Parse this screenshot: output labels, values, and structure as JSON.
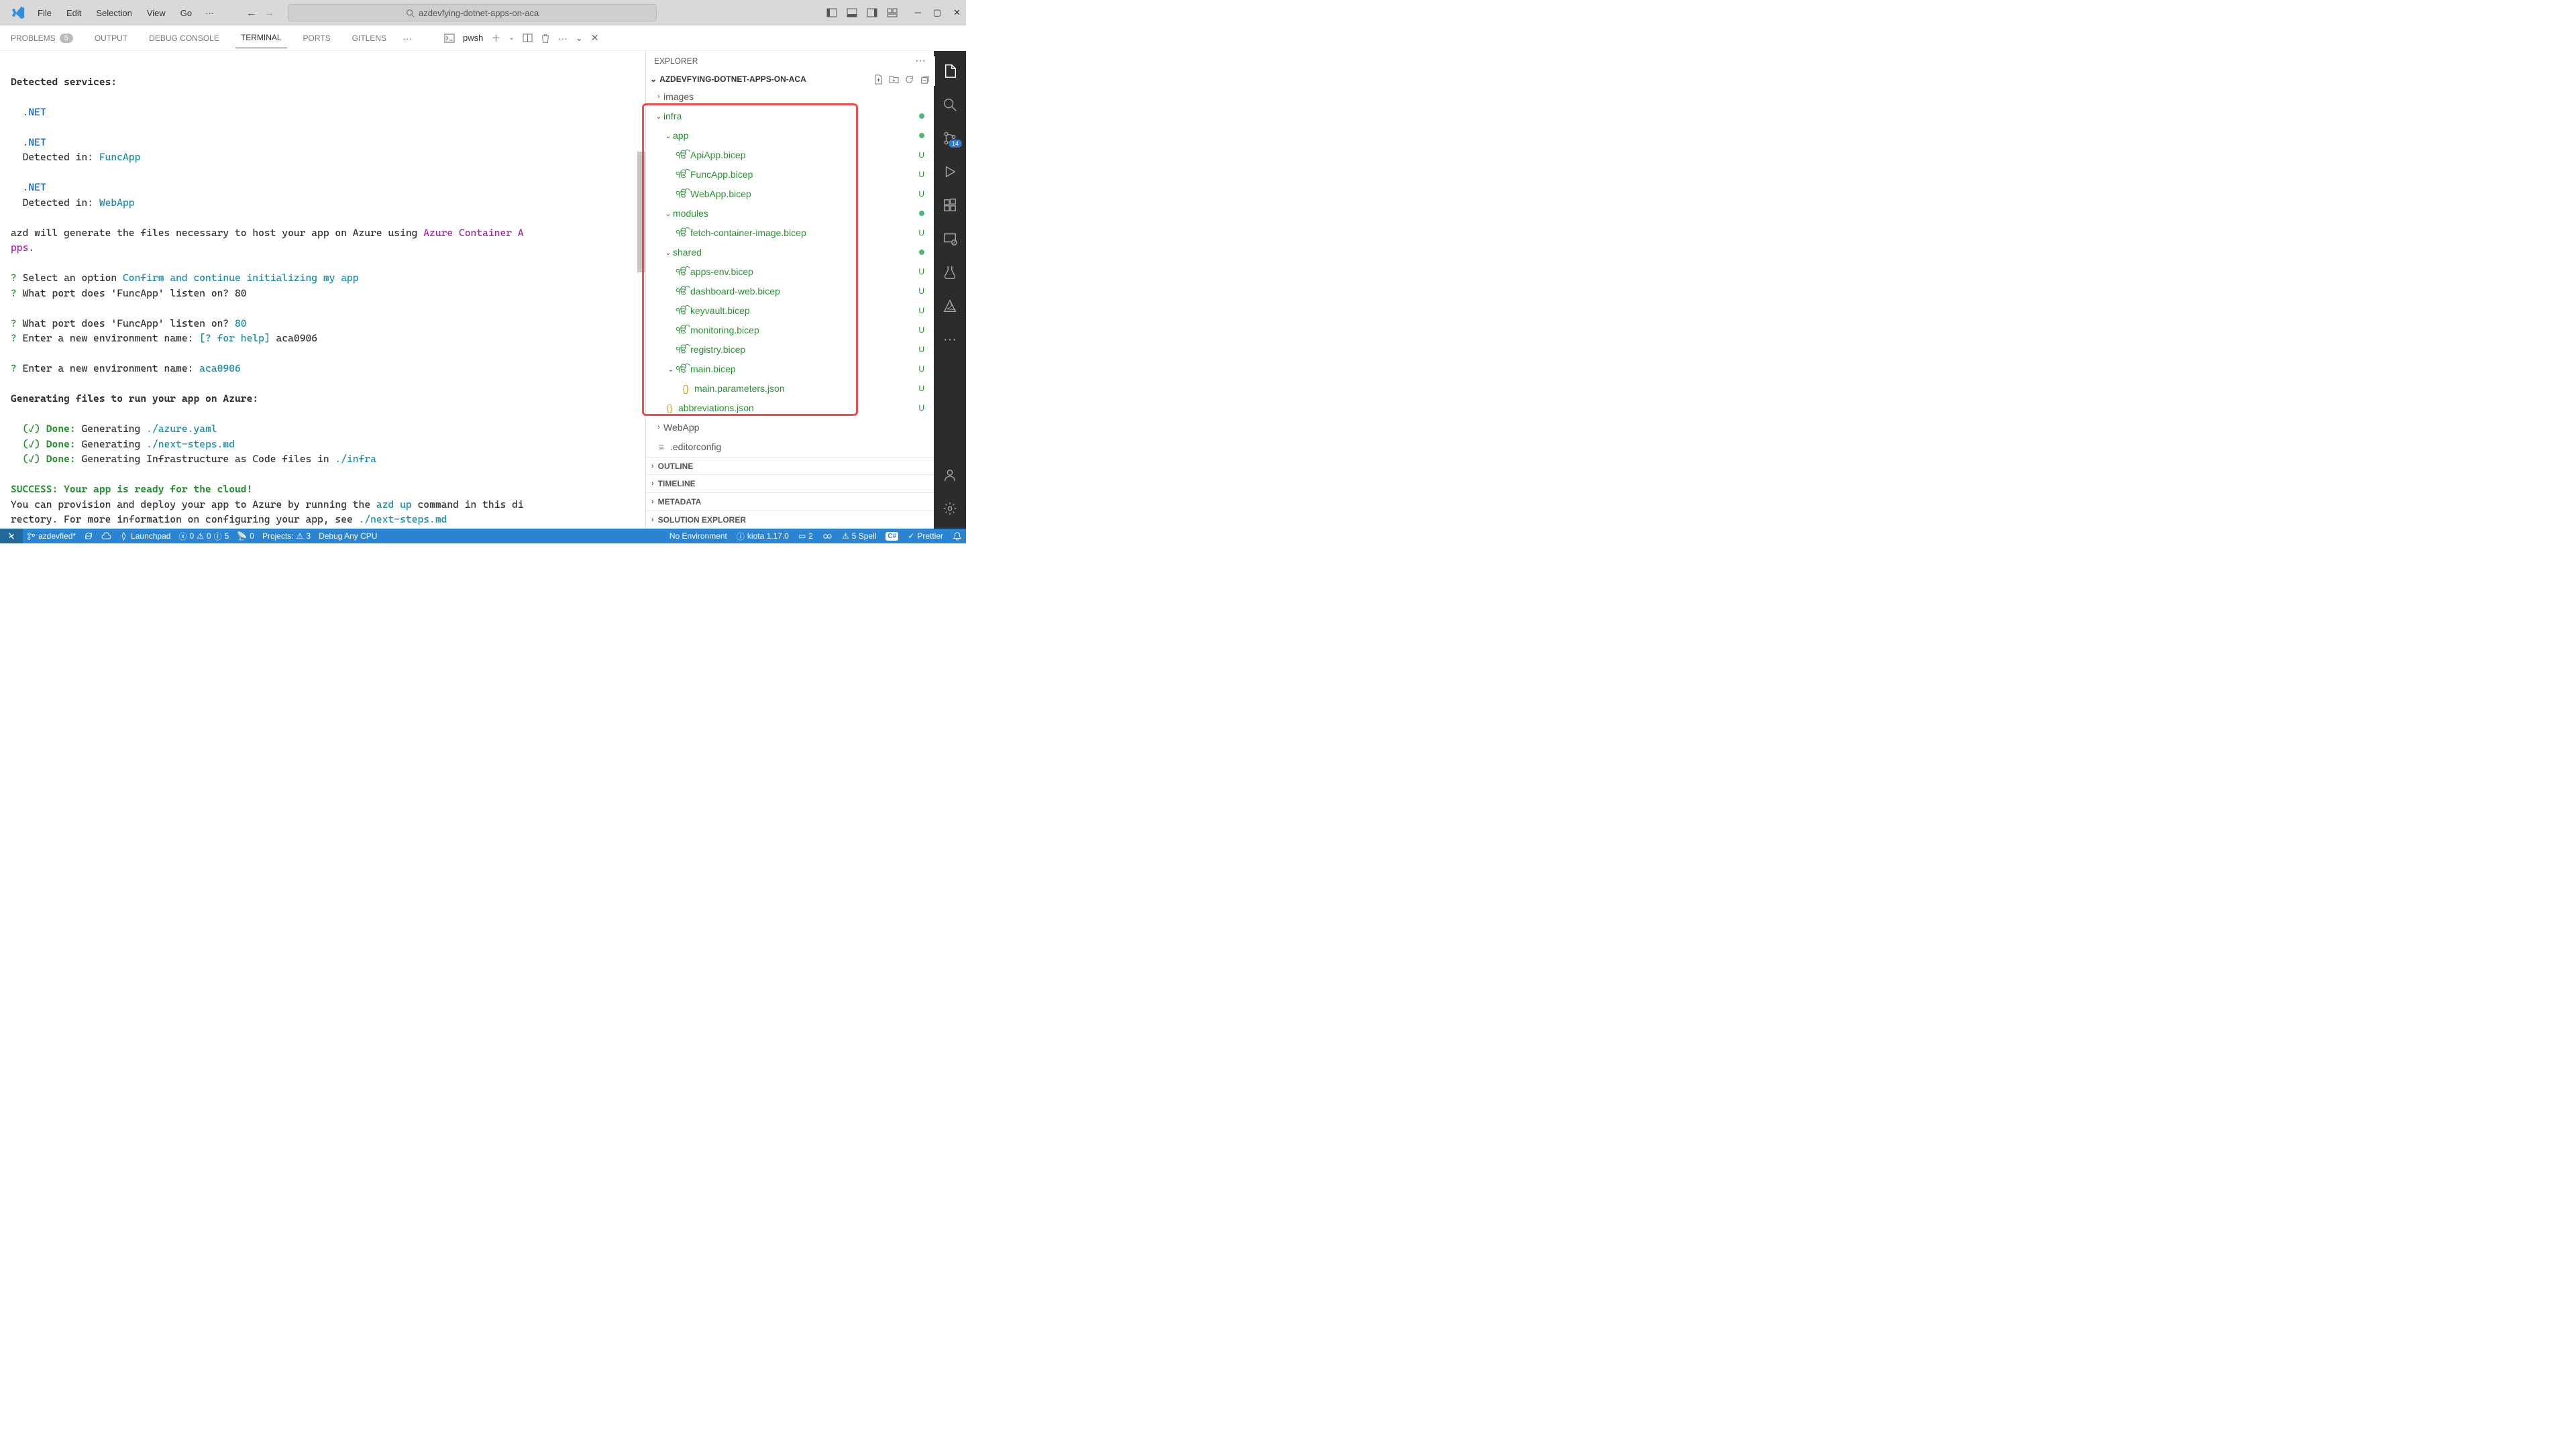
{
  "titlebar": {
    "menu": [
      "File",
      "Edit",
      "Selection",
      "View",
      "Go"
    ],
    "search": "azdevfying-dotnet-apps-on-aca"
  },
  "panel": {
    "tabs": {
      "problems": "PROBLEMS",
      "problems_badge": "5",
      "output": "OUTPUT",
      "debug": "DEBUG CONSOLE",
      "terminal": "TERMINAL",
      "ports": "PORTS",
      "gitlens": "GITLENS"
    },
    "shell": "pwsh"
  },
  "terminal": {
    "detected_heading": "Detected services:",
    "net": ".NET",
    "det_in": "Detected in: ",
    "func": "FuncApp",
    "web": "WebApp",
    "azd_gen": "azd will generate the files necessary to host your app on Azure using ",
    "aca": "Azure Container A",
    "pps": "pps",
    "q": "?",
    "sel_opt": " Select an option ",
    "confirm": "Confirm and continue initializing my app",
    "port_q": " What port does 'FuncApp' listen on? ",
    "port_80": "80",
    "env_q": " Enter a new environment name: ",
    "env_help": "[? for help] ",
    "env_val": "aca0906",
    "gen_heading": "Generating files to run your app on Azure:",
    "done": "Done:",
    "check_open": "(",
    "check": "✓",
    "check_close": ") ",
    "gen1": " Generating ",
    "gen1_file": "./azure.yaml",
    "gen2_file": "./next-steps.md",
    "gen3": " Generating Infrastructure as Code files in ",
    "gen3_dir": "./infra",
    "success": "SUCCESS: Your app is ready for the cloud!",
    "tail1a": "You can provision and deploy your app to Azure by running the ",
    "tail1b": "azd up",
    "tail1c": " command in this di",
    "tail2a": "rectory. For more information on configuring your app, see ",
    "tail2b": "./next-steps.md"
  },
  "explorer": {
    "header": "EXPLORER",
    "title": "AZDEVFYING-DOTNET-APPS-ON-ACA",
    "items": {
      "images": "images",
      "infra": "infra",
      "app": "app",
      "apiapp": "ApiApp.bicep",
      "funcapp": "FuncApp.bicep",
      "webapp_b": "WebApp.bicep",
      "modules": "modules",
      "fetch": "fetch-container-image.bicep",
      "shared": "shared",
      "appsenv": "apps-env.bicep",
      "dashboard": "dashboard-web.bicep",
      "keyvault": "keyvault.bicep",
      "monitoring": "monitoring.bicep",
      "registry": "registry.bicep",
      "main": "main.bicep",
      "mainparams": "main.parameters.json",
      "abbrev": "abbreviations.json",
      "webapp_folder": "WebApp",
      "editorconfig": ".editorconfig"
    },
    "sections": {
      "outline": "OUTLINE",
      "timeline": "TIMELINE",
      "metadata": "METADATA",
      "solution": "SOLUTION EXPLORER"
    },
    "status_u": "U"
  },
  "activity": {
    "scm_badge": "14"
  },
  "statusbar": {
    "branch": "azdevfied*",
    "launchpad": "Launchpad",
    "err_x": "0",
    "err_w": "0",
    "err_i": "5",
    "radio": "0",
    "projects": "Projects:",
    "projects_n": "3",
    "debug": "Debug Any CPU",
    "noenv": "No Environment",
    "kiota": "kiota 1.17.0",
    "two": "2",
    "spell": "5 Spell",
    "prettier": "Prettier"
  }
}
